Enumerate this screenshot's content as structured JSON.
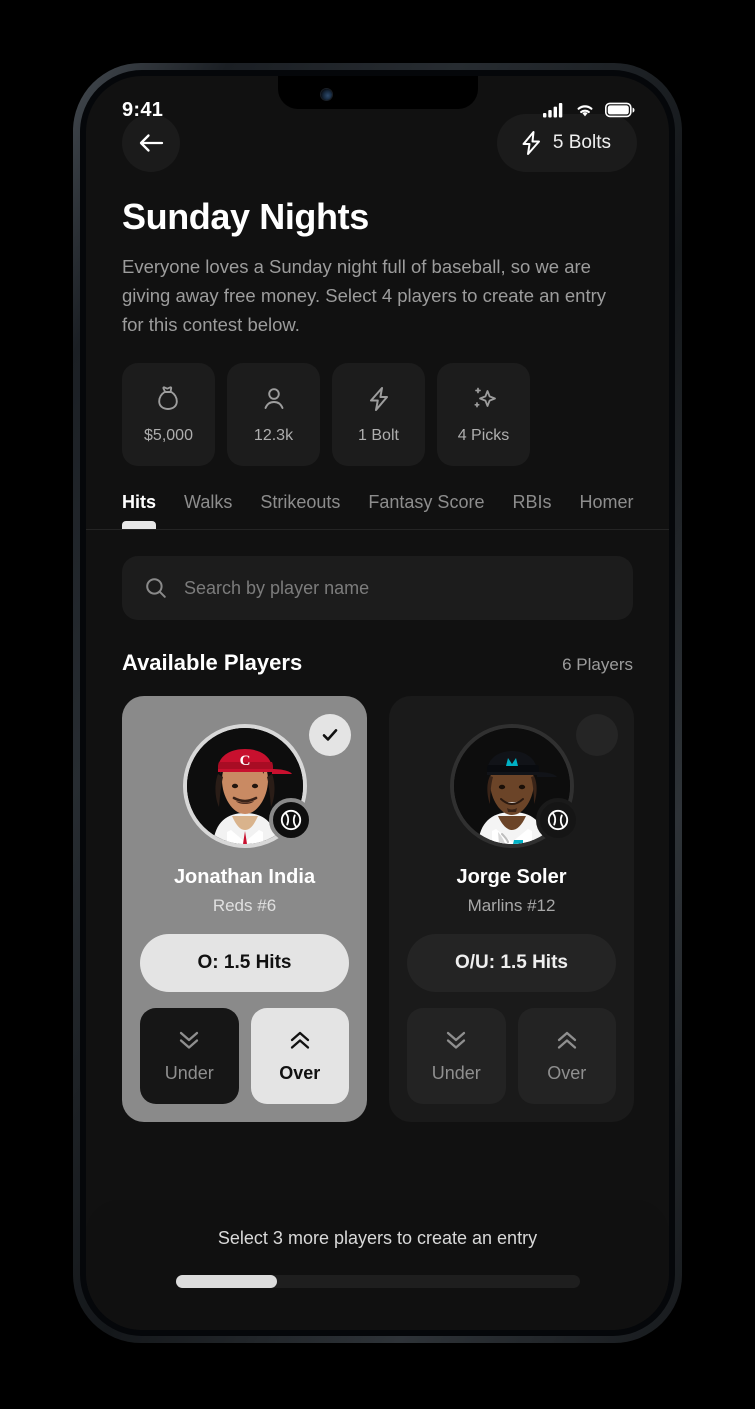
{
  "status_bar": {
    "time": "9:41",
    "icons": [
      "cellular-signal-icon",
      "wifi-icon",
      "battery-icon"
    ]
  },
  "header": {
    "back_icon": "arrow-left-icon",
    "bolts_icon": "bolt-icon",
    "bolts_label": "5 Bolts"
  },
  "contest": {
    "title": "Sunday Nights",
    "description": "Everyone loves a Sunday night full of baseball, so we are giving away free money. Select 4 players to create an entry for this contest below."
  },
  "stats": [
    {
      "icon": "money-bag-icon",
      "value": "$5,000"
    },
    {
      "icon": "person-icon",
      "value": "12.3k"
    },
    {
      "icon": "bolt-icon",
      "value": "1 Bolt"
    },
    {
      "icon": "sparkle-icon",
      "value": "4 Picks"
    }
  ],
  "tabs": [
    {
      "label": "Hits",
      "active": true
    },
    {
      "label": "Walks",
      "active": false
    },
    {
      "label": "Strikeouts",
      "active": false
    },
    {
      "label": "Fantasy Score",
      "active": false
    },
    {
      "label": "RBIs",
      "active": false
    },
    {
      "label": "Homer",
      "active": false
    }
  ],
  "search": {
    "icon": "search-icon",
    "placeholder": "Search by player name",
    "value": ""
  },
  "players_section": {
    "title": "Available Players",
    "count_label": "6 Players"
  },
  "players": [
    {
      "name": "Jonathan India",
      "team": "Reds #6",
      "line": "O: 1.5 Hits",
      "selected": true,
      "badge_icon": "check-icon",
      "sport_icon": "baseball-icon",
      "under_label": "Under",
      "over_label": "Over",
      "under_icon": "chevron-double-down-icon",
      "over_icon": "chevron-double-up-icon",
      "pick": "over",
      "cap_color": "#c8102e",
      "skin_color": "#c98a63",
      "jersey_color": "#f2f2f2"
    },
    {
      "name": "Jorge Soler",
      "team": "Marlins #12",
      "line": "O/U: 1.5 Hits",
      "selected": false,
      "badge_icon": "empty-circle-icon",
      "sport_icon": "baseball-icon",
      "under_label": "Under",
      "over_label": "Over",
      "under_icon": "chevron-double-down-icon",
      "over_icon": "chevron-double-up-icon",
      "pick": "none",
      "cap_color": "#111111",
      "skin_color": "#6b4428",
      "jersey_color": "#f4f4f4"
    }
  ],
  "bottom": {
    "status_text": "Select 3 more players to create an entry",
    "progress_percent": 25
  },
  "colors": {
    "screen_bg": "#111111",
    "card_bg": "#1a1a1a",
    "selected_card_bg": "#8a8a8a",
    "accent_light": "#e4e4e4",
    "text_primary": "#ffffff",
    "text_secondary": "#9c9c9c"
  }
}
